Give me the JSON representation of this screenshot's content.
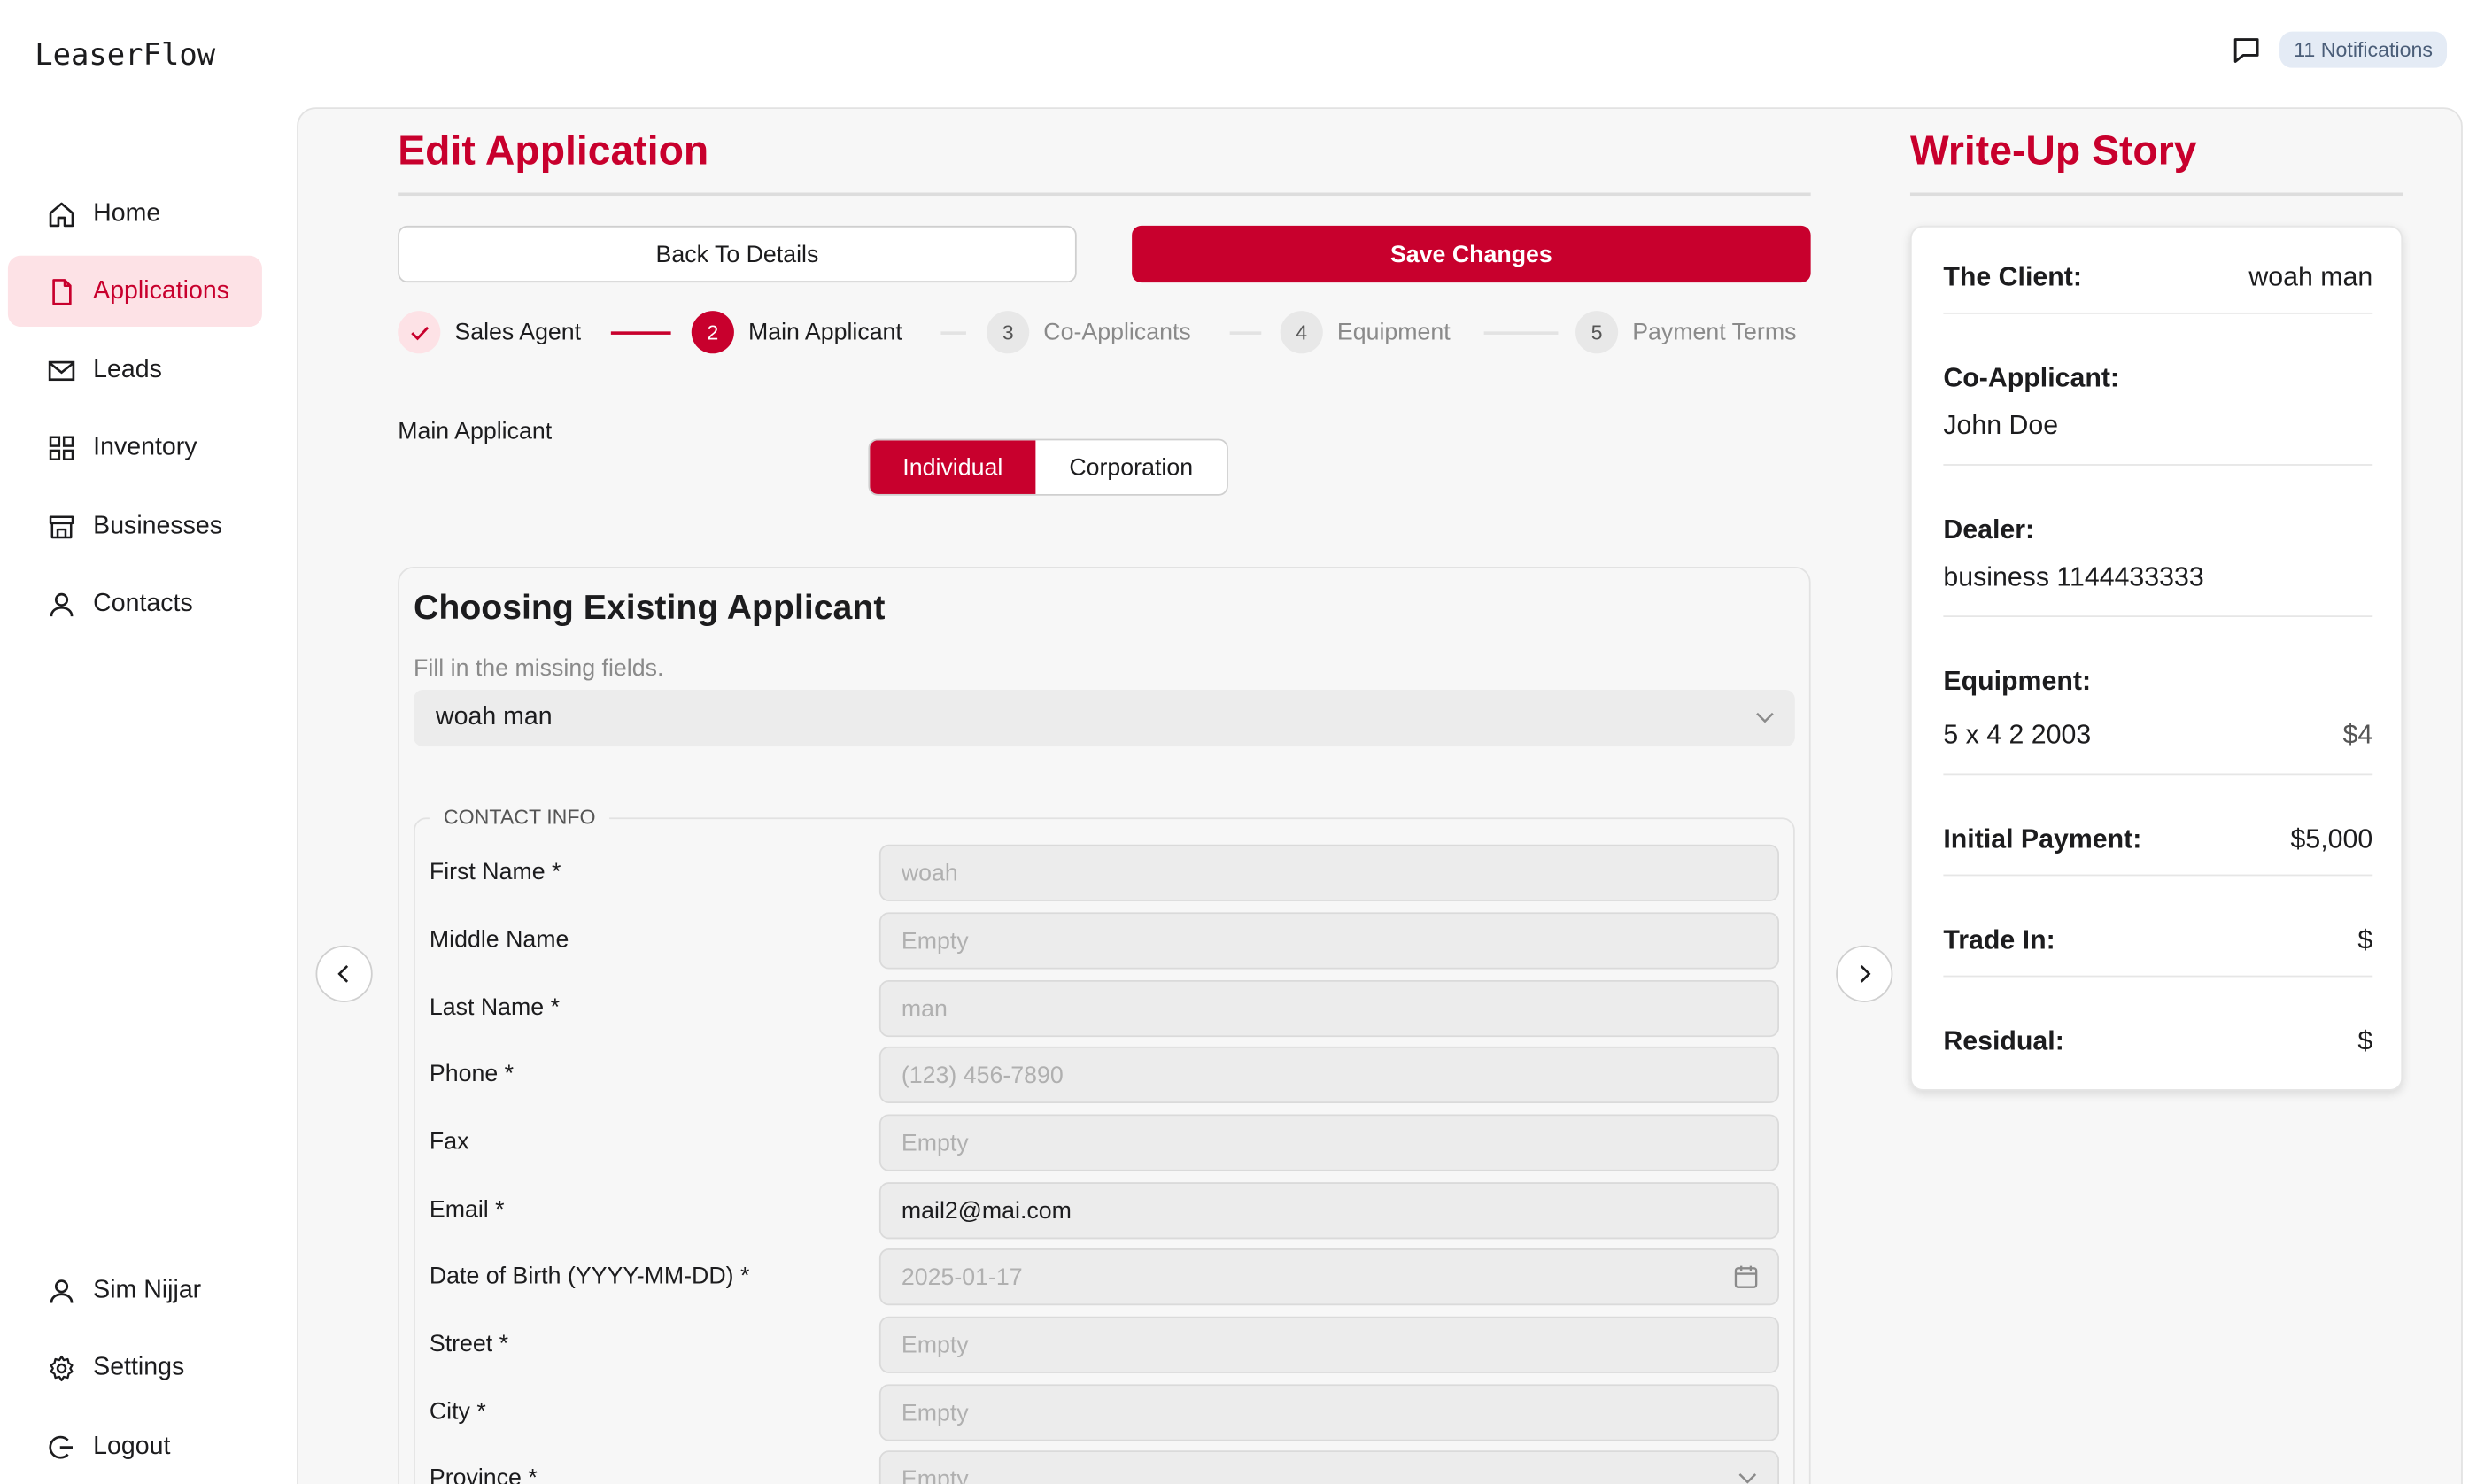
{
  "app": {
    "name": "LeaserFlow"
  },
  "topbar": {
    "notifications_label": "11 Notifications"
  },
  "sidebar": {
    "items": [
      {
        "label": "Home",
        "icon": "home-icon"
      },
      {
        "label": "Applications",
        "icon": "document-icon",
        "active": true
      },
      {
        "label": "Leads",
        "icon": "mail-icon"
      },
      {
        "label": "Inventory",
        "icon": "grid-icon"
      },
      {
        "label": "Businesses",
        "icon": "store-icon"
      },
      {
        "label": "Contacts",
        "icon": "user-icon"
      }
    ],
    "bottom": [
      {
        "label": "Sim Nijjar",
        "icon": "user-icon"
      },
      {
        "label": "Settings",
        "icon": "gear-icon"
      },
      {
        "label": "Logout",
        "icon": "logout-icon"
      }
    ]
  },
  "editor": {
    "title": "Edit Application",
    "back_label": "Back To Details",
    "save_label": "Save Changes",
    "steps": [
      {
        "number": "",
        "label": "Sales Agent",
        "state": "done"
      },
      {
        "number": "2",
        "label": "Main Applicant",
        "state": "current"
      },
      {
        "number": "3",
        "label": "Co-Applicants",
        "state": "todo"
      },
      {
        "number": "4",
        "label": "Equipment",
        "state": "todo"
      },
      {
        "number": "5",
        "label": "Payment Terms",
        "state": "todo"
      }
    ],
    "applicant_type_label": "Main Applicant",
    "applicant_type_options": [
      "Individual",
      "Corporation"
    ],
    "applicant_type_selected": "Individual",
    "card_title": "Choosing Existing Applicant",
    "card_subtitle": "Fill in the missing fields.",
    "selected_applicant": "woah man",
    "section_legend": "CONTACT INFO",
    "fields": [
      {
        "label": "First Name *",
        "value": "",
        "placeholder": "woah"
      },
      {
        "label": "Middle Name",
        "value": "",
        "placeholder": "Empty"
      },
      {
        "label": "Last Name *",
        "value": "",
        "placeholder": "man"
      },
      {
        "label": "Phone *",
        "value": "",
        "placeholder": "(123) 456-7890"
      },
      {
        "label": "Fax",
        "value": "",
        "placeholder": "Empty"
      },
      {
        "label": "Email *",
        "value": "mail2@mai.com",
        "placeholder": ""
      },
      {
        "label": "Date of Birth (YYYY-MM-DD) *",
        "value": "",
        "placeholder": "2025-01-17"
      },
      {
        "label": "Street *",
        "value": "",
        "placeholder": "Empty"
      },
      {
        "label": "City *",
        "value": "",
        "placeholder": "Empty"
      },
      {
        "label": "Province *",
        "value": "",
        "placeholder": "Empty"
      }
    ]
  },
  "story": {
    "title": "Write-Up Story",
    "client_label": "The Client:",
    "client_value": "woah man",
    "coapplicant_label": "Co-Applicant:",
    "coapplicant_value": "John Doe",
    "dealer_label": "Dealer:",
    "dealer_value": "business 1144433333",
    "equipment_label": "Equipment:",
    "equipment_item": "5 x 4 2 2003",
    "equipment_price": "$4",
    "initial_payment_label": "Initial Payment:",
    "initial_payment_value": "$5,000",
    "trade_in_label": "Trade In:",
    "trade_in_value": "$",
    "residual_label": "Residual:",
    "residual_value": "$"
  },
  "colors": {
    "accent": "#c8002d",
    "accent_soft": "#fde2e6",
    "panel": "#f7f7f7"
  }
}
